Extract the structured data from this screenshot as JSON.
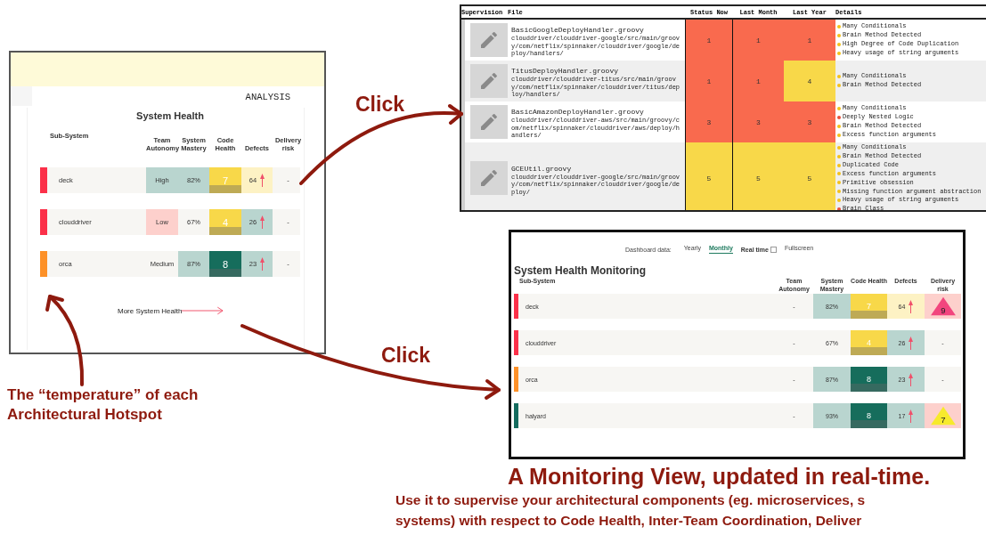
{
  "details_panel": {
    "columns": [
      "Supervision",
      "File",
      "Status Now",
      "Last Month",
      "Last Year",
      "Details"
    ],
    "rows": [
      {
        "file": "BasicGoogleDeployHandler.groovy",
        "path": "clouddriver/clouddriver-google/src/main/groovy/com/netflix/spinnaker/clouddriver/google/deploy/handlers/",
        "status_now": {
          "text": "1",
          "color": "#f96a4e"
        },
        "last_month": {
          "text": "1",
          "color": "#f96a4e"
        },
        "last_year": {
          "text": "1",
          "color": "#f96a4e"
        },
        "details": [
          {
            "text": "Many Conditionals",
            "color": "#f2c21b"
          },
          {
            "text": "Brain Method Detected",
            "color": "#f2c21b"
          },
          {
            "text": "High Degree of Code Duplication",
            "color": "#f2c21b"
          },
          {
            "text": "Heavy usage of string arguments",
            "color": "#f2c21b"
          }
        ]
      },
      {
        "file": "TitusDeployHandler.groovy",
        "path": "clouddriver/clouddriver-titus/src/main/groovy/com/netflix/spinnaker/clouddriver/titus/deploy/handlers/",
        "status_now": {
          "text": "1",
          "color": "#f96a4e"
        },
        "last_month": {
          "text": "1",
          "color": "#f96a4e"
        },
        "last_year": {
          "text": "4",
          "color": "#f8d849"
        },
        "details": [
          {
            "text": "Many Conditionals",
            "color": "#f2c21b"
          },
          {
            "text": "Brain Method Detected",
            "color": "#f2c21b"
          }
        ]
      },
      {
        "file": "BasicAmazonDeployHandler.groovy",
        "path": "clouddriver/clouddriver-aws/src/main/groovy/com/netflix/spinnaker/clouddriver/aws/deploy/handlers/",
        "status_now": {
          "text": "3",
          "color": "#f96a4e"
        },
        "last_month": {
          "text": "3",
          "color": "#f96a4e"
        },
        "last_year": {
          "text": "3",
          "color": "#f96a4e"
        },
        "details": [
          {
            "text": "Many Conditionals",
            "color": "#f2c21b"
          },
          {
            "text": "Deeply Nested Logic",
            "color": "#e8503a"
          },
          {
            "text": "Brain Method Detected",
            "color": "#f2c21b"
          },
          {
            "text": "Excess function arguments",
            "color": "#f2c21b"
          }
        ]
      },
      {
        "file": "GCEUtil.groovy",
        "path": "clouddriver/clouddriver-google/src/main/groovy/com/netflix/spinnaker/clouddriver/google/deploy/",
        "status_now": {
          "text": "5",
          "color": "#f8d849"
        },
        "last_month": {
          "text": "5",
          "color": "#f8d849"
        },
        "last_year": {
          "text": "5",
          "color": "#f8d849"
        },
        "details": [
          {
            "text": "Many Conditionals",
            "color": "#f2c21b"
          },
          {
            "text": "Brain Method Detected",
            "color": "#f2c21b"
          },
          {
            "text": "Duplicated Code",
            "color": "#f2c21b"
          },
          {
            "text": "Excess function arguments",
            "color": "#f2c21b"
          },
          {
            "text": "Primitive obsession",
            "color": "#f2c21b"
          },
          {
            "text": "Missing function argument abstraction",
            "color": "#f2c21b"
          },
          {
            "text": "Heavy usage of string arguments",
            "color": "#f2c21b"
          },
          {
            "text": "Brain Class",
            "color": "#e8503a"
          }
        ]
      }
    ]
  },
  "analysis_panel": {
    "tab": "ANALYSIS",
    "title": "System Health",
    "columns": [
      "Sub-System",
      "Team Autonomy",
      "System Mastery",
      "Code Health",
      "Defects",
      "Delivery risk"
    ],
    "rows": [
      {
        "name": "deck",
        "color": "#fb3049",
        "team_autonomy": {
          "text": "High",
          "color": "#b9d5cf"
        },
        "mastery": {
          "text": "82%",
          "color": "#b9d5cf"
        },
        "code_health": {
          "text": "7",
          "color": "#f8d849"
        },
        "defects": {
          "text": "64",
          "color": "#fdf2c4",
          "rising": true
        },
        "delivery_risk": {
          "text": "-",
          "kind": "text"
        }
      },
      {
        "name": "clouddriver",
        "color": "#fb3049",
        "team_autonomy": {
          "text": "Low",
          "color": "#fdd0cc"
        },
        "mastery": {
          "text": "67%"
        },
        "code_health": {
          "text": "4",
          "color": "#f8d849"
        },
        "defects": {
          "text": "26",
          "color": "#b9d5cf",
          "rising": true
        },
        "delivery_risk": {
          "text": "-",
          "kind": "text"
        }
      },
      {
        "name": "orca",
        "color": "#fd9128",
        "team_autonomy": {
          "text": "Medium"
        },
        "mastery": {
          "text": "87%",
          "color": "#b9d5cf"
        },
        "code_health": {
          "text": "8",
          "color": "#166d5c"
        },
        "defects": {
          "text": "23",
          "color": "#b9d5cf",
          "rising": true
        },
        "delivery_risk": {
          "text": "-",
          "kind": "text"
        }
      }
    ],
    "more_link": "More System Health"
  },
  "clicks": [
    "Click",
    "Click"
  ],
  "monitoring_panel": {
    "toolbar_label": "Dashboard data:",
    "periods": [
      {
        "label": "Yearly",
        "selected": false
      },
      {
        "label": "Monthly",
        "selected": true
      }
    ],
    "real_time": {
      "label": "Real time",
      "checked": false
    },
    "fullscreen": "Fullscreen",
    "title": "System Health Monitoring",
    "columns": [
      "Sub-System",
      "Team Autonomy",
      "System Mastery",
      "Code Health",
      "Defects",
      "Delivery risk"
    ],
    "rows": [
      {
        "name": "deck",
        "color": "#fb3049",
        "team_autonomy": {
          "text": "-"
        },
        "mastery": {
          "text": "82%",
          "color": "#b9d5cf"
        },
        "code_health": {
          "text": "7",
          "color": "#f8d849"
        },
        "defects": {
          "text": "64",
          "color": "#fdf2c4",
          "rising": true
        },
        "delivery_risk": {
          "text": "9",
          "kind": "triangle",
          "color": "#f2457e"
        }
      },
      {
        "name": "clouddriver",
        "color": "#fb3049",
        "team_autonomy": {
          "text": "-"
        },
        "mastery": {
          "text": "67%"
        },
        "code_health": {
          "text": "4",
          "color": "#f8d849"
        },
        "defects": {
          "text": "26",
          "color": "#b9d5cf",
          "rising": true
        },
        "delivery_risk": {
          "text": "-",
          "kind": "text"
        }
      },
      {
        "name": "orca",
        "color": "#fd9128",
        "team_autonomy": {
          "text": "-"
        },
        "mastery": {
          "text": "87%",
          "color": "#b9d5cf"
        },
        "code_health": {
          "text": "8",
          "color": "#166d5c"
        },
        "defects": {
          "text": "23",
          "color": "#b9d5cf",
          "rising": true
        },
        "delivery_risk": {
          "text": "-",
          "kind": "text"
        }
      },
      {
        "name": "halyard",
        "color": "#146b5e",
        "team_autonomy": {
          "text": "-"
        },
        "mastery": {
          "text": "93%",
          "color": "#b9d5cf"
        },
        "code_health": {
          "text": "8",
          "color": "#166d5c"
        },
        "defects": {
          "text": "17",
          "color": "#b9d5cf",
          "rising": true
        },
        "delivery_risk": {
          "text": "7",
          "kind": "triangle",
          "color": "#f7ea2c"
        }
      }
    ]
  },
  "caption": "The “temperature” of each Architectural Hotspot",
  "headline": "A Monitoring View, updated in real-time.",
  "body_lines": [
    "Use it to supervise your architectural components (eg. microservices, s",
    "systems) with respect to Code Health, Inter-Team Coordination, Deliver"
  ]
}
